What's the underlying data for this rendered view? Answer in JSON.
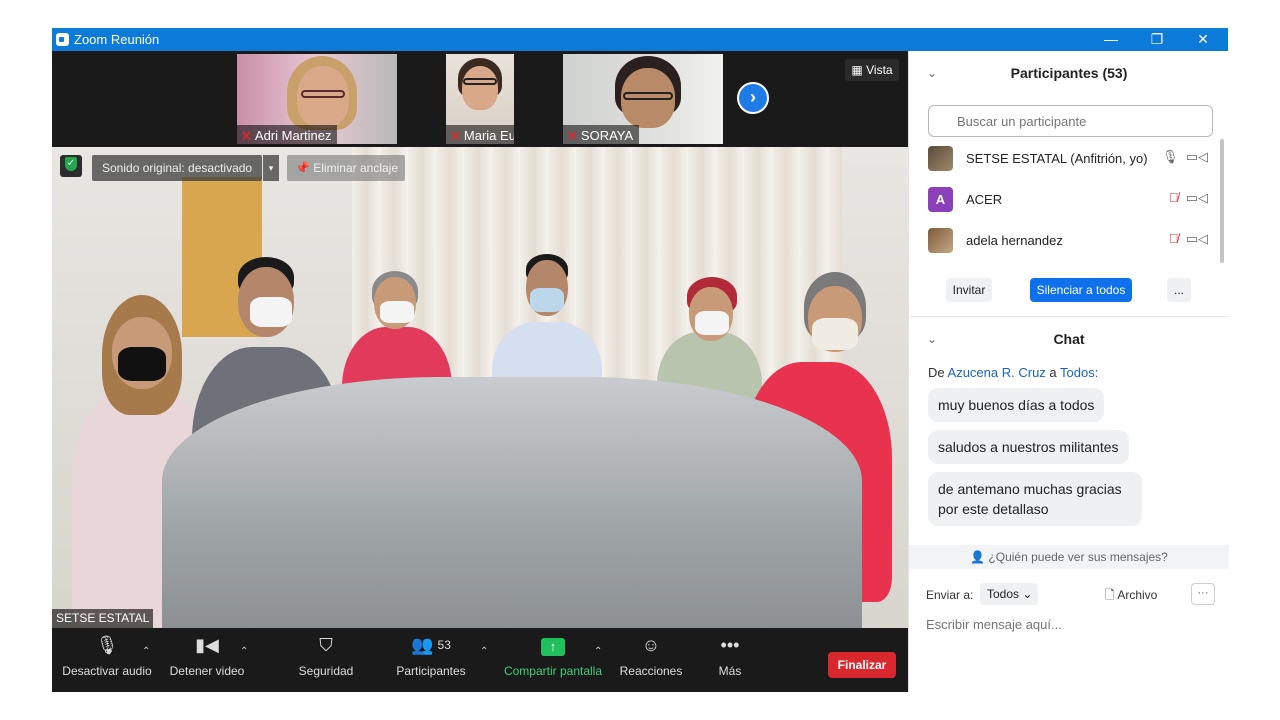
{
  "window": {
    "title": "Zoom Reunión",
    "minimize": "—",
    "restore": "❐",
    "close": "✕"
  },
  "thumbnails": [
    {
      "name": "Adri Martinez"
    },
    {
      "name": "Maria Eugeni..."
    },
    {
      "name": "SORAYA"
    }
  ],
  "vista": "Vista",
  "main_video": {
    "sonido": "Sonido original: desactivado",
    "eliminar": "Eliminar anclaje",
    "speaker": "SETSE ESTATAL"
  },
  "toolbar": {
    "audio": "Desactivar audio",
    "video": "Detener video",
    "security": "Seguridad",
    "participants": "Participantes",
    "participant_count": "53",
    "share": "Compartir pantalla",
    "reactions": "Reacciones",
    "more": "Más",
    "end": "Finalizar"
  },
  "participants_panel": {
    "header": "Participantes (53)",
    "search_placeholder": "Buscar un participante",
    "list": [
      {
        "name": "SETSE ESTATAL (Anfitrión, yo)",
        "avatar": "",
        "color": "#5a4a3a"
      },
      {
        "name": "ACER",
        "avatar": "A",
        "color": "#8b3fb8"
      },
      {
        "name": "adela hernandez",
        "avatar": "",
        "color": "#7a5a3a"
      }
    ],
    "invite": "Invitar",
    "mute_all": "Silenciar a todos",
    "more": "..."
  },
  "chat": {
    "header": "Chat",
    "from_prefix": "De",
    "from_name": "Azucena R. Cruz",
    "to_word": "a",
    "to_name": "Todos:",
    "messages": [
      "muy buenos días a todos",
      "saludos a nuestros militantes",
      "de antemano muchas gracias por este detallaso"
    ],
    "who_can_see": "¿Quién puede ver sus mensajes?",
    "send_to_label": "Enviar a:",
    "send_to_value": "Todos",
    "file": "Archivo",
    "more": "···",
    "input_placeholder": "Escribir mensaje aquí..."
  },
  "colors": {
    "titlebar": "#0b7ad8",
    "end_button": "#d8282d",
    "share_green": "#1fc05d",
    "link_blue": "#1763c6",
    "muted_red": "#e0282e"
  }
}
